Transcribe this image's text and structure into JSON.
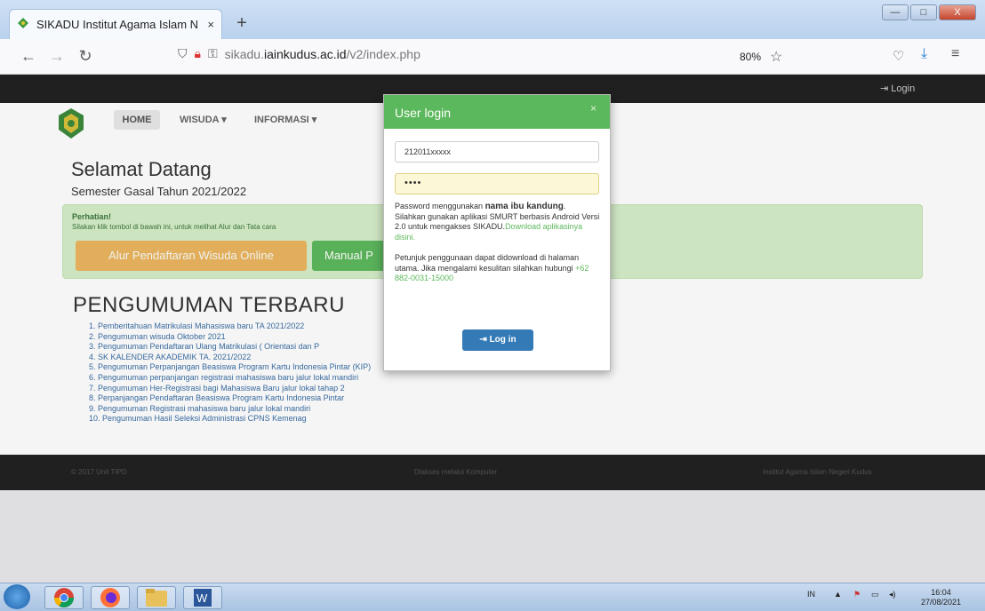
{
  "browser": {
    "tab_title": "SIKADU Institut Agama Islam N",
    "tab_close": "×",
    "new_tab": "+",
    "url_host": "sikadu.",
    "url_domain": "iainkudus.ac.id",
    "url_path": "/v2/index.php",
    "zoom": "80%",
    "controls": {
      "minimize": "—",
      "maximize": "□",
      "close": "X"
    }
  },
  "site": {
    "top_login": "Login",
    "menu": {
      "home": "HOME",
      "wisuda": "WISUDA ▾",
      "informasi": "INFORMASI ▾"
    },
    "welcome_title": "Selamat Datang",
    "semester": "Semester Gasal Tahun 2021/2022",
    "alert_title": "Perhatian!",
    "alert_text": "Silakan klik tombol di bawah ini, untuk melihat Alur dan Tata cara",
    "btn_alur": "Alur Pendaftaran Wisuda Online",
    "btn_manual": "Manual P",
    "announce_title": "PENGUMUMAN TERBARU",
    "announcements": [
      "1. Pemberitahuan Matrikulasi Mahasiswa baru TA 2021/2022",
      "2. Pengumuman wisuda Oktober 2021",
      "3. Pengumuman Pendaftaran Ulang Matrikulasi ( Orientasi dan P",
      "4. SK KALENDER AKADEMIK TA. 2021/2022",
      "5. Pengumuman Perpanjangan Beasiswa Program Kartu Indonesia Pintar (KIP)",
      "6. Pengumuman perpanjangan registrasi mahasiswa baru jalur lokal mandiri",
      "7. Pengumuman Her-Registrasi bagi Mahasiswa Baru jalur lokal tahap 2",
      "8. Perpanjangan Pendaftaran Beasiswa Program Kartu Indonesia Pintar",
      "9. Pengumuman Registrasi mahasiswa baru jalur lokal mandiri",
      "10. Pengumuman Hasil Seleksi Administrasi CPNS Kemenag"
    ],
    "footer": {
      "left": "© 2017 Unit TIPD",
      "center": "Diakses melalui Komputer",
      "right": "Institut Agama Islam Negeri Kudus"
    }
  },
  "modal": {
    "title": "User login",
    "close": "×",
    "username": "212011xxxxx",
    "password_mask": "••••",
    "text1a": "Password menggunakan ",
    "text1b": "nama ibu kandung",
    "text1c": ".",
    "text2": "Silahkan gunakan aplikasi SMURT berbasis Android Versi 2.0 untuk mengakses SIKADU.",
    "download_link": "Download aplikasinya disini.",
    "text3": "Petunjuk penggunaan dapat didownload di halaman utama. Jika mengalami kesulitan silahkan hubungi ",
    "phone": "+62 882-0031-15000",
    "login_button": "Log in"
  },
  "taskbar": {
    "lang": "IN",
    "time": "16:04",
    "date": "27/08/2021"
  },
  "colors": {
    "green": "#5cb85c",
    "blue": "#337ab7",
    "orange": "#f0ad4e",
    "dark": "#222222"
  }
}
